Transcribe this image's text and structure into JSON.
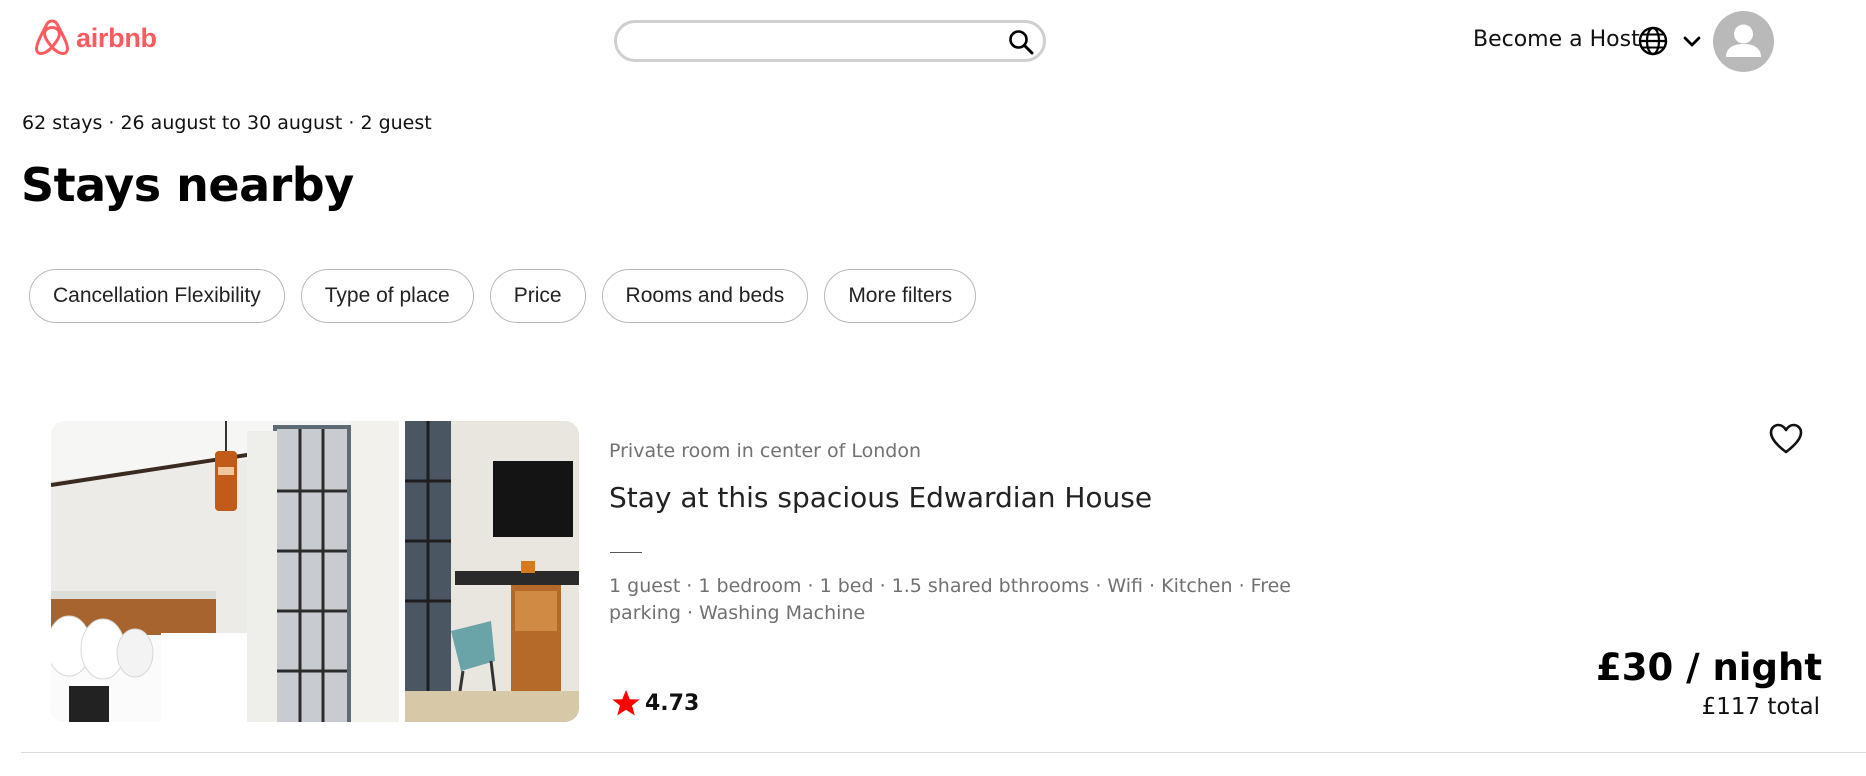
{
  "header": {
    "brand": "airbnb",
    "search": {
      "value": "",
      "placeholder": ""
    },
    "host_link": "Become a Host",
    "icons": [
      "airbnb-logo-icon",
      "search-icon",
      "globe-icon",
      "chevron-down-icon",
      "user-icon"
    ]
  },
  "summary": "62 stays · 26 august to 30 august · 2 guest",
  "page_title": "Stays nearby",
  "filters": [
    "Cancellation Flexibility",
    "Type of place",
    "Price",
    "Rooms and beds",
    "More filters"
  ],
  "listing": {
    "kicker": "Private room in center of London",
    "title": "Stay at this spacious Edwardian House",
    "amenities": "1 guest · 1 bedroom · 1 bed · 1.5 shared bthrooms · Wifi · Kitchen · Free parking · Washing Machine",
    "rating": "4.73",
    "price": "£30 / night",
    "total": "£117 total"
  },
  "colors": {
    "brand": "#ff5a5f",
    "rating_star": "#ff0000",
    "muted_text": "#717171",
    "chip_border": "#b8b8b8"
  }
}
